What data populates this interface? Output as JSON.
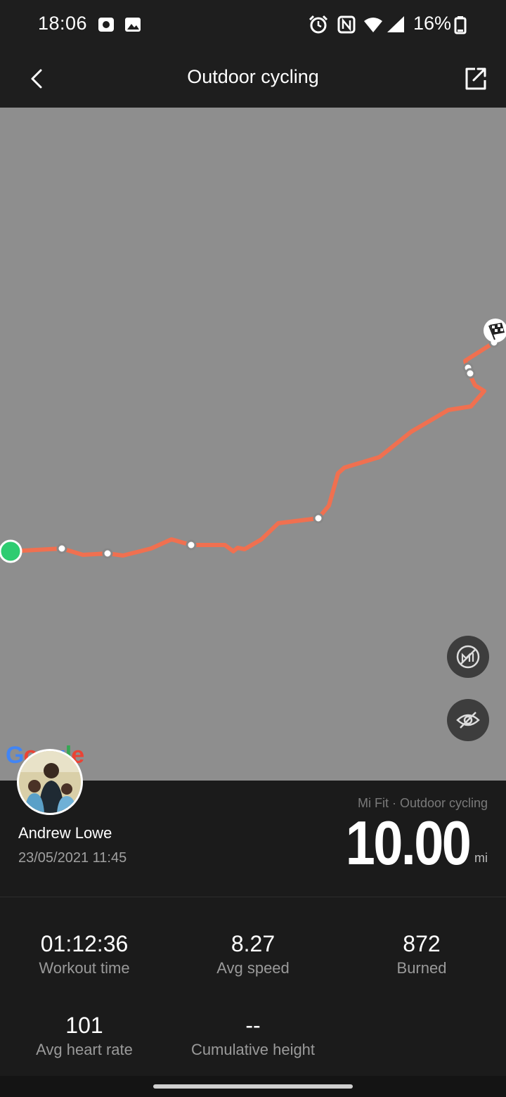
{
  "status_bar": {
    "time": "18:06",
    "battery": "16%",
    "left_icons": [
      "screenshot-icon",
      "image-icon"
    ],
    "right_icons": [
      "alarm-icon",
      "nfc-icon",
      "wifi-icon",
      "signal-icon",
      "battery-icon"
    ]
  },
  "header": {
    "title": "Outdoor cycling",
    "back_icon": "back-chevron-icon",
    "share_icon": "share-icon"
  },
  "map": {
    "route_color": "#f07050",
    "start_color": "#2ecc71",
    "google_logo": "Google",
    "buttons": [
      "distance-markers-toggle-icon",
      "hide-route-icon"
    ]
  },
  "profile": {
    "name": "Andrew Lowe",
    "date": "23/05/2021 11:45",
    "source": "Mi Fit · Outdoor cycling",
    "distance": "10.00",
    "distance_unit": "mi"
  },
  "stats": [
    {
      "value": "01:12:36",
      "label": "Workout time"
    },
    {
      "value": "8.27",
      "label": "Avg speed"
    },
    {
      "value": "872",
      "label": "Burned"
    },
    {
      "value": "101",
      "label": "Avg heart rate"
    },
    {
      "value": "--",
      "label": "Cumulative height"
    }
  ]
}
